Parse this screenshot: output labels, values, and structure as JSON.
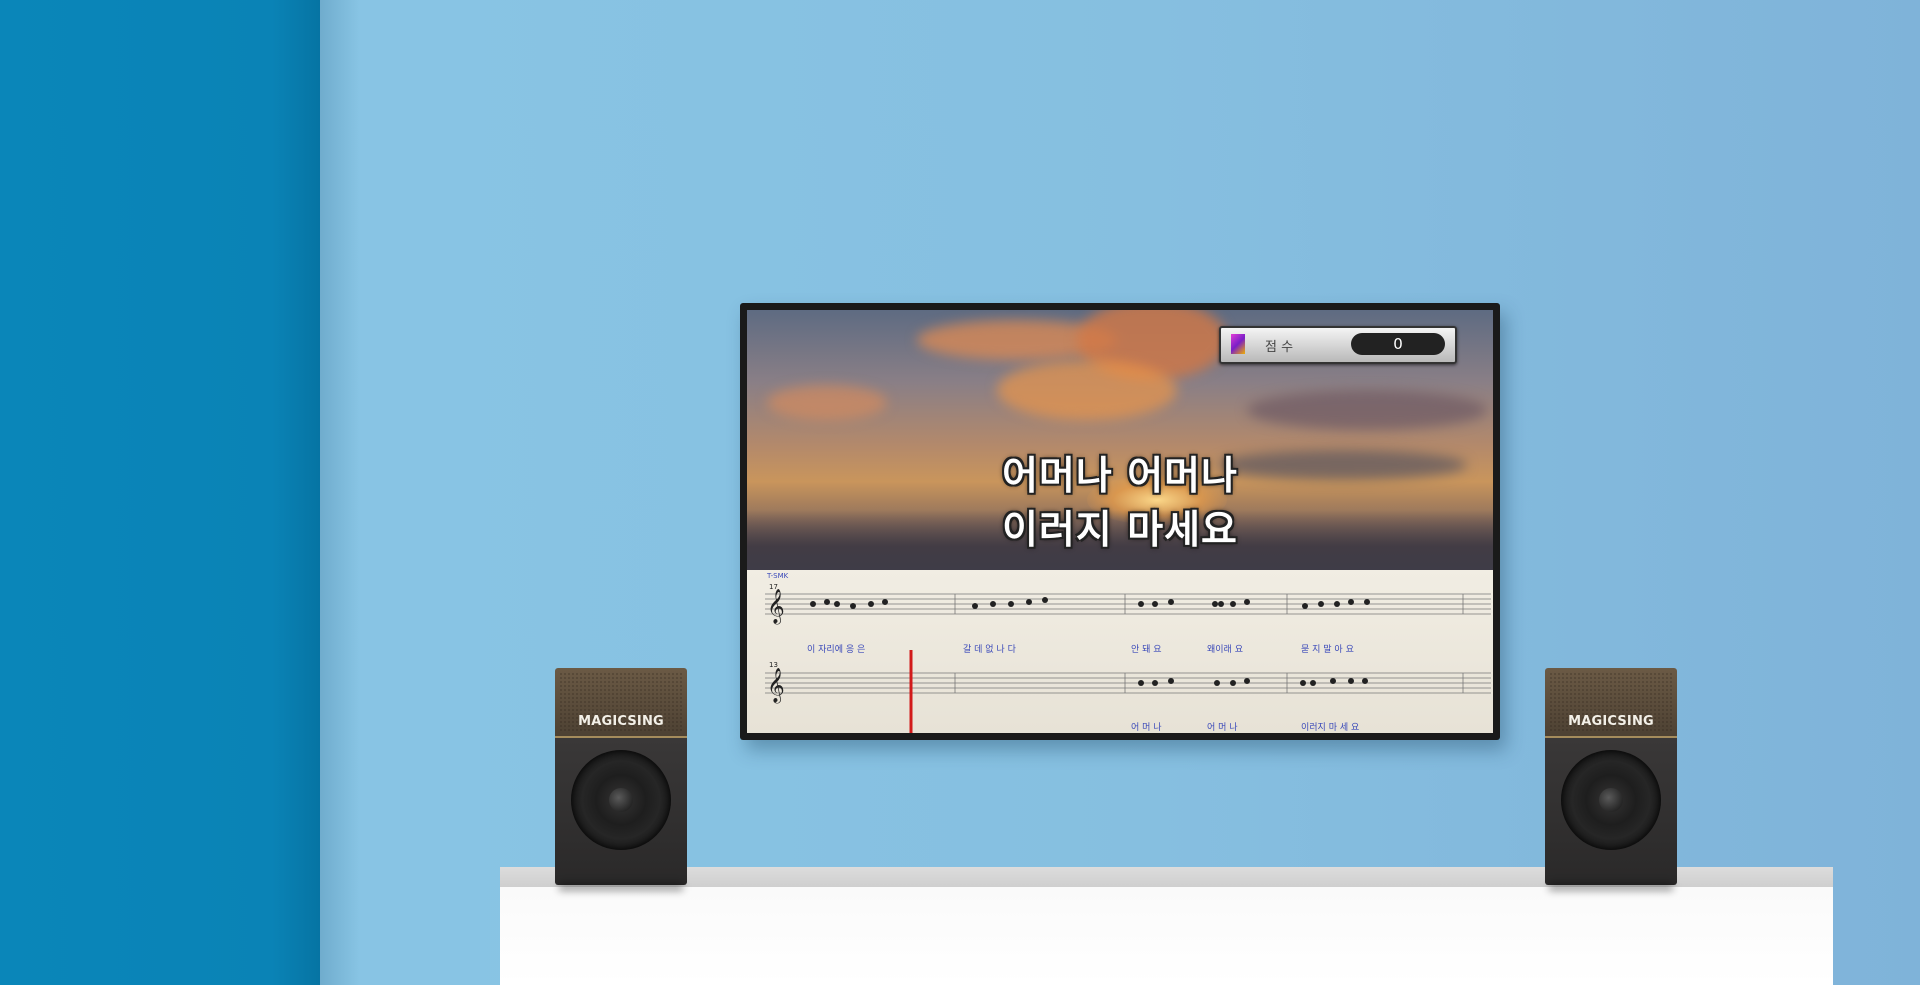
{
  "tv": {
    "lyrics": [
      "어머나 어머나",
      "이러지 마세요"
    ],
    "score": {
      "label": "점 수",
      "value": "0"
    },
    "sheet": {
      "top_label": "T-SMK",
      "row1_number": "17",
      "row2_number": "13",
      "row1_lyrics": [
        "이 자리에 응 은",
        "갈 데 없 나 다",
        "안 돼 요",
        "왜이래 요",
        "묻 지 말 아 요"
      ],
      "row2_lyrics": [
        "어 머 나",
        "어 머 나",
        "이러지 마 세 요"
      ]
    }
  },
  "speakers": {
    "brand": "MAGICSING"
  },
  "colors": {
    "wall": "#89c7e6",
    "left_panel": "#0a86b9",
    "shelf": "#ffffff",
    "lyric_blue": "#3a49b9"
  }
}
